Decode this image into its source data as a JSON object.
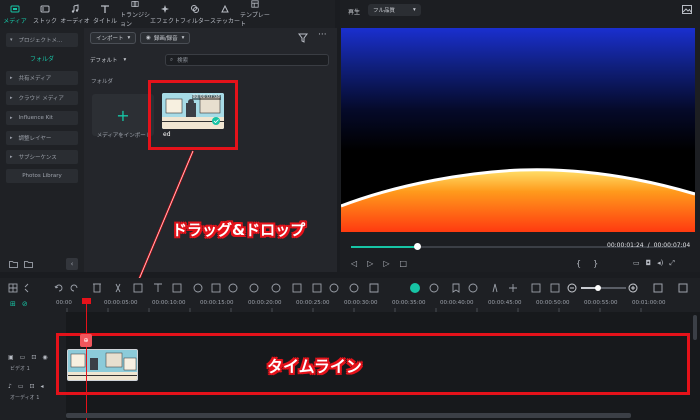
{
  "tabs": [
    {
      "label": "メディア",
      "icon": "media-icon",
      "active": true
    },
    {
      "label": "ストック",
      "icon": "stock-icon"
    },
    {
      "label": "オーディオ",
      "icon": "audio-icon"
    },
    {
      "label": "タイトル",
      "icon": "title-icon"
    },
    {
      "label": "トランジション",
      "icon": "transition-icon"
    },
    {
      "label": "エフェクト",
      "icon": "effect-icon"
    },
    {
      "label": "フィルター",
      "icon": "filter-icon"
    },
    {
      "label": "ステッカー",
      "icon": "sticker-icon"
    },
    {
      "label": "テンプレート",
      "icon": "template-icon"
    }
  ],
  "sidebar": {
    "project": "プロジェクトメ...",
    "folder": "フォルダ",
    "items": [
      "共有メディア",
      "クラウド メディア",
      "Influence Kit",
      "調整レイヤー",
      "サブシーケンス"
    ],
    "photos_library": "Photos Library"
  },
  "media": {
    "import_btn": "インポート",
    "record_btn": "録画/録音",
    "sort": "デフォルト",
    "search_placeholder": "検索",
    "folder_label": "フォルダ",
    "import_tile_label": "メディアをインポート",
    "clip_name": "ed",
    "thumb_time": "00:00:07:04"
  },
  "preview": {
    "play_label": "再生",
    "quality": "フル品質",
    "current": "00:00:01:24",
    "sep": "/",
    "total": "00:00:07:04"
  },
  "ruler": [
    "00:00",
    "00:00:05:00",
    "00:00:10:00",
    "00:00:15:00",
    "00:00:20:00",
    "00:00:25:00",
    "00:00:30:00",
    "00:00:35:00",
    "00:00:40:00",
    "00:00:45:00",
    "00:00:50:00",
    "00:00:55:00",
    "00:01:00:00"
  ],
  "tracks": {
    "video": "ビデオ 1",
    "audio": "オーディオ 1"
  },
  "annotations": {
    "drag": "ドラッグ&ドロップ",
    "timeline": "タイムライン"
  },
  "colors": {
    "accent": "#17c4a5",
    "annotation_red": "#e5121a"
  }
}
